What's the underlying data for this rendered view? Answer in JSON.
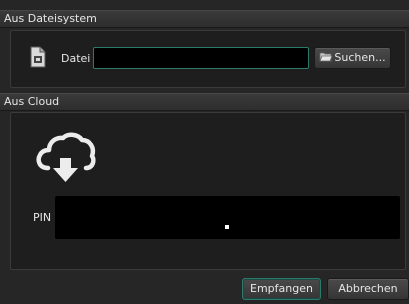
{
  "filesystem": {
    "header": "Aus Dateisystem",
    "file_label": "Datei",
    "file_value": "",
    "browse_label": "Suchen..."
  },
  "cloud": {
    "header": "Aus Cloud",
    "pin_label": "PIN",
    "icon": "cloud-download-icon"
  },
  "footer": {
    "receive_label": "Empfangen",
    "cancel_label": "Abbrechen"
  },
  "colors": {
    "background": "#262626",
    "panel": "#1e1e1e",
    "focus_border": "#2b7a6c",
    "pin_background": "#000000"
  }
}
